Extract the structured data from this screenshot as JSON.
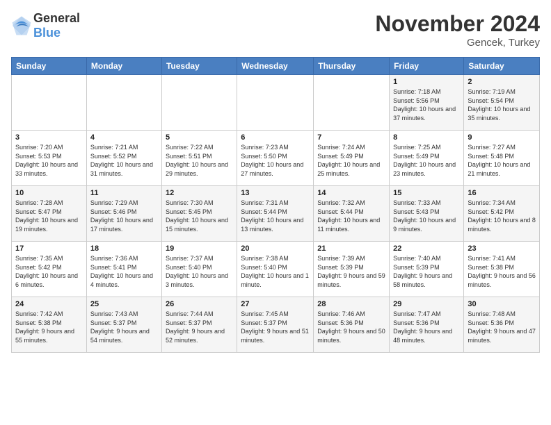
{
  "header": {
    "logo_general": "General",
    "logo_blue": "Blue",
    "month_title": "November 2024",
    "location": "Gencek, Turkey"
  },
  "days_of_week": [
    "Sunday",
    "Monday",
    "Tuesday",
    "Wednesday",
    "Thursday",
    "Friday",
    "Saturday"
  ],
  "weeks": [
    [
      {
        "day": "",
        "info": ""
      },
      {
        "day": "",
        "info": ""
      },
      {
        "day": "",
        "info": ""
      },
      {
        "day": "",
        "info": ""
      },
      {
        "day": "",
        "info": ""
      },
      {
        "day": "1",
        "info": "Sunrise: 7:18 AM\nSunset: 5:56 PM\nDaylight: 10 hours and 37 minutes."
      },
      {
        "day": "2",
        "info": "Sunrise: 7:19 AM\nSunset: 5:54 PM\nDaylight: 10 hours and 35 minutes."
      }
    ],
    [
      {
        "day": "3",
        "info": "Sunrise: 7:20 AM\nSunset: 5:53 PM\nDaylight: 10 hours and 33 minutes."
      },
      {
        "day": "4",
        "info": "Sunrise: 7:21 AM\nSunset: 5:52 PM\nDaylight: 10 hours and 31 minutes."
      },
      {
        "day": "5",
        "info": "Sunrise: 7:22 AM\nSunset: 5:51 PM\nDaylight: 10 hours and 29 minutes."
      },
      {
        "day": "6",
        "info": "Sunrise: 7:23 AM\nSunset: 5:50 PM\nDaylight: 10 hours and 27 minutes."
      },
      {
        "day": "7",
        "info": "Sunrise: 7:24 AM\nSunset: 5:49 PM\nDaylight: 10 hours and 25 minutes."
      },
      {
        "day": "8",
        "info": "Sunrise: 7:25 AM\nSunset: 5:49 PM\nDaylight: 10 hours and 23 minutes."
      },
      {
        "day": "9",
        "info": "Sunrise: 7:27 AM\nSunset: 5:48 PM\nDaylight: 10 hours and 21 minutes."
      }
    ],
    [
      {
        "day": "10",
        "info": "Sunrise: 7:28 AM\nSunset: 5:47 PM\nDaylight: 10 hours and 19 minutes."
      },
      {
        "day": "11",
        "info": "Sunrise: 7:29 AM\nSunset: 5:46 PM\nDaylight: 10 hours and 17 minutes."
      },
      {
        "day": "12",
        "info": "Sunrise: 7:30 AM\nSunset: 5:45 PM\nDaylight: 10 hours and 15 minutes."
      },
      {
        "day": "13",
        "info": "Sunrise: 7:31 AM\nSunset: 5:44 PM\nDaylight: 10 hours and 13 minutes."
      },
      {
        "day": "14",
        "info": "Sunrise: 7:32 AM\nSunset: 5:44 PM\nDaylight: 10 hours and 11 minutes."
      },
      {
        "day": "15",
        "info": "Sunrise: 7:33 AM\nSunset: 5:43 PM\nDaylight: 10 hours and 9 minutes."
      },
      {
        "day": "16",
        "info": "Sunrise: 7:34 AM\nSunset: 5:42 PM\nDaylight: 10 hours and 8 minutes."
      }
    ],
    [
      {
        "day": "17",
        "info": "Sunrise: 7:35 AM\nSunset: 5:42 PM\nDaylight: 10 hours and 6 minutes."
      },
      {
        "day": "18",
        "info": "Sunrise: 7:36 AM\nSunset: 5:41 PM\nDaylight: 10 hours and 4 minutes."
      },
      {
        "day": "19",
        "info": "Sunrise: 7:37 AM\nSunset: 5:40 PM\nDaylight: 10 hours and 3 minutes."
      },
      {
        "day": "20",
        "info": "Sunrise: 7:38 AM\nSunset: 5:40 PM\nDaylight: 10 hours and 1 minute."
      },
      {
        "day": "21",
        "info": "Sunrise: 7:39 AM\nSunset: 5:39 PM\nDaylight: 9 hours and 59 minutes."
      },
      {
        "day": "22",
        "info": "Sunrise: 7:40 AM\nSunset: 5:39 PM\nDaylight: 9 hours and 58 minutes."
      },
      {
        "day": "23",
        "info": "Sunrise: 7:41 AM\nSunset: 5:38 PM\nDaylight: 9 hours and 56 minutes."
      }
    ],
    [
      {
        "day": "24",
        "info": "Sunrise: 7:42 AM\nSunset: 5:38 PM\nDaylight: 9 hours and 55 minutes."
      },
      {
        "day": "25",
        "info": "Sunrise: 7:43 AM\nSunset: 5:37 PM\nDaylight: 9 hours and 54 minutes."
      },
      {
        "day": "26",
        "info": "Sunrise: 7:44 AM\nSunset: 5:37 PM\nDaylight: 9 hours and 52 minutes."
      },
      {
        "day": "27",
        "info": "Sunrise: 7:45 AM\nSunset: 5:37 PM\nDaylight: 9 hours and 51 minutes."
      },
      {
        "day": "28",
        "info": "Sunrise: 7:46 AM\nSunset: 5:36 PM\nDaylight: 9 hours and 50 minutes."
      },
      {
        "day": "29",
        "info": "Sunrise: 7:47 AM\nSunset: 5:36 PM\nDaylight: 9 hours and 48 minutes."
      },
      {
        "day": "30",
        "info": "Sunrise: 7:48 AM\nSunset: 5:36 PM\nDaylight: 9 hours and 47 minutes."
      }
    ]
  ]
}
